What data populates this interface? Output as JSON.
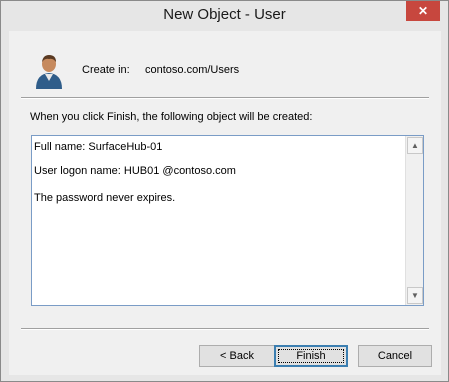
{
  "window": {
    "title": "New Object - User",
    "close_glyph": "✕"
  },
  "header": {
    "icon": "user-icon",
    "create_in_label": "Create in:",
    "create_in_value": "contoso.com/Users"
  },
  "summary": {
    "intro": "When you click Finish, the following object will be created:",
    "lines": [
      "Full name: SurfaceHub-01",
      "User logon name:    HUB01 @contoso.com",
      "The password never expires."
    ]
  },
  "scrollbar": {
    "up_glyph": "▲",
    "down_glyph": "▼"
  },
  "buttons": {
    "back": "< Back",
    "finish": "Finish",
    "cancel": "Cancel"
  }
}
